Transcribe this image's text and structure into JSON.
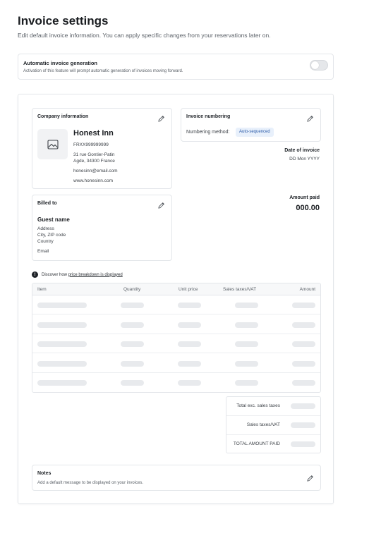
{
  "header": {
    "title": "Invoice settings",
    "subtitle": "Edit default invoice information. You can apply specific changes from your reservations later on."
  },
  "auto_invoice": {
    "title": "Automatic invoice generation",
    "description": "Activation of this feature will prompt automatic generation of invoices moving forward.",
    "enabled": false
  },
  "company": {
    "title": "Company information",
    "name": "Honest Inn",
    "vat": "FRXX999999999",
    "address_line1": "31 rue Gontier-Patin",
    "address_line2": "Agde, 34300 France",
    "email": "honesinn@email.com",
    "website": "www.honesinn.com"
  },
  "numbering": {
    "title": "Invoice numbering",
    "method_label": "Numbering method:",
    "method_value": "Auto-sequenced"
  },
  "date": {
    "label": "Date of invoice",
    "value": "DD Mon YYYY"
  },
  "amount": {
    "label": "Amount paid",
    "value": "000.00"
  },
  "billed": {
    "title": "Billed to",
    "guest_name": "Guest name",
    "address": "Address",
    "city": "City, ZIP code",
    "country": "Country",
    "email": "Email"
  },
  "breakdown": {
    "prefix": "Discover how ",
    "link": "price breakdown is displayed"
  },
  "table": {
    "columns": [
      "Item",
      "Quantity",
      "Unit price",
      "Sales taxes/VAT",
      "Amount"
    ],
    "row_count": 5
  },
  "totals": {
    "rows": [
      "Total exc. sales taxes",
      "Sales taxes/VAT",
      "TOTAL AMOUNT PAID"
    ]
  },
  "notes": {
    "title": "Notes",
    "description": "Add a default message to be displayed on your invoices."
  }
}
